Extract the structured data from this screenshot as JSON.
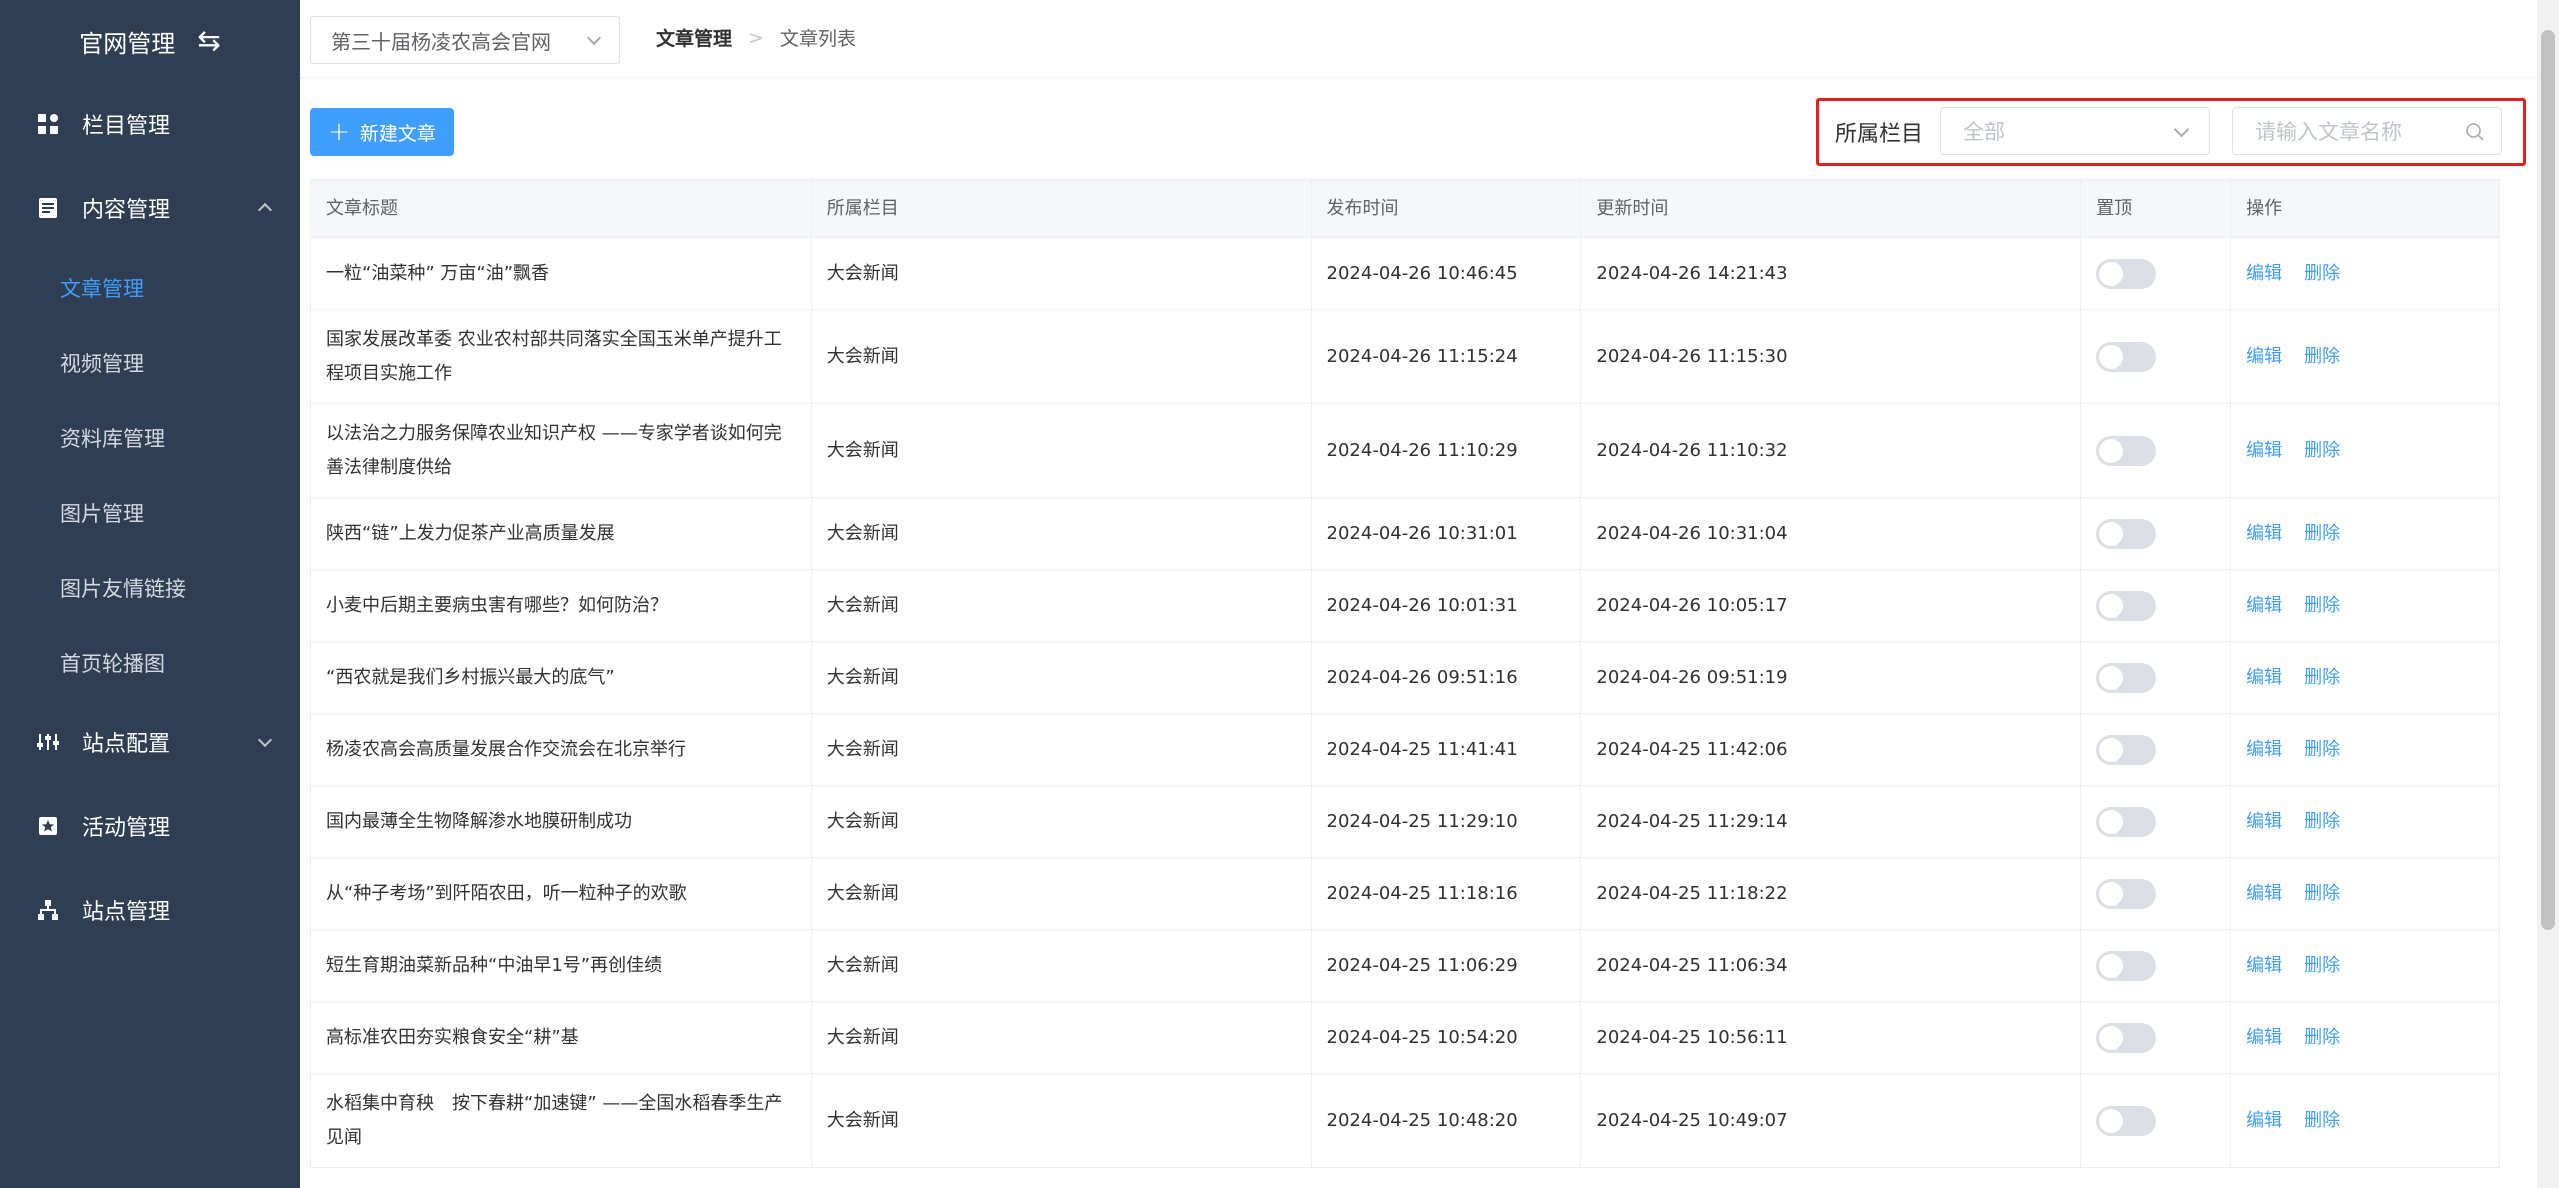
{
  "sidebar": {
    "brand": "官网管理",
    "swap_icon": "⇆",
    "menu": [
      {
        "label": "栏目管理",
        "icon": "grid-icon"
      },
      {
        "label": "内容管理",
        "icon": "document-icon"
      },
      {
        "label": "站点配置",
        "icon": "sliders-icon"
      },
      {
        "label": "活动管理",
        "icon": "star-box-icon"
      },
      {
        "label": "站点管理",
        "icon": "sitemap-icon"
      }
    ],
    "submenu": [
      "文章管理",
      "视频管理",
      "资料库管理",
      "图片管理",
      "图片友情链接",
      "首页轮播图"
    ],
    "active_sub": "文章管理"
  },
  "header": {
    "site_select_value": "第三十届杨凌农高会官网",
    "breadcrumb": [
      "文章管理",
      "文章列表"
    ],
    "breadcrumb_sep": ">"
  },
  "toolbar": {
    "new_label": "新建文章",
    "filter_label": "所属栏目",
    "filter_select_placeholder": "全部",
    "search_placeholder": "请输入文章名称"
  },
  "table": {
    "columns": [
      "文章标题",
      "所属栏目",
      "发布时间",
      "更新时间",
      "置顶",
      "操作"
    ],
    "edit_label": "编辑",
    "delete_label": "删除",
    "rows": [
      {
        "title": "一粒“油菜种” 万亩“油”飘香",
        "category": "大会新闻",
        "published": "2024-04-26 10:46:45",
        "updated": "2024-04-26 14:21:43",
        "pinned": false
      },
      {
        "title": "国家发展改革委 农业农村部共同落实全国玉米单产提升工程项目实施工作",
        "category": "大会新闻",
        "published": "2024-04-26 11:15:24",
        "updated": "2024-04-26 11:15:30",
        "pinned": false
      },
      {
        "title": "以法治之力服务保障农业知识产权 ——专家学者谈如何完善法律制度供给",
        "category": "大会新闻",
        "published": "2024-04-26 11:10:29",
        "updated": "2024-04-26 11:10:32",
        "pinned": false
      },
      {
        "title": "陕西“链”上发力促茶产业高质量发展",
        "category": "大会新闻",
        "published": "2024-04-26 10:31:01",
        "updated": "2024-04-26 10:31:04",
        "pinned": false
      },
      {
        "title": "小麦中后期主要病虫害有哪些？如何防治？",
        "category": "大会新闻",
        "published": "2024-04-26 10:01:31",
        "updated": "2024-04-26 10:05:17",
        "pinned": false
      },
      {
        "title": "“西农就是我们乡村振兴最大的底气”",
        "category": "大会新闻",
        "published": "2024-04-26 09:51:16",
        "updated": "2024-04-26 09:51:19",
        "pinned": false
      },
      {
        "title": "杨凌农高会高质量发展合作交流会在北京举行",
        "category": "大会新闻",
        "published": "2024-04-25 11:41:41",
        "updated": "2024-04-25 11:42:06",
        "pinned": false
      },
      {
        "title": "国内最薄全生物降解渗水地膜研制成功",
        "category": "大会新闻",
        "published": "2024-04-25 11:29:10",
        "updated": "2024-04-25 11:29:14",
        "pinned": false
      },
      {
        "title": "从“种子考场”到阡陌农田，听一粒种子的欢歌",
        "category": "大会新闻",
        "published": "2024-04-25 11:18:16",
        "updated": "2024-04-25 11:18:22",
        "pinned": false
      },
      {
        "title": "短生育期油菜新品种“中油早1号”再创佳绩",
        "category": "大会新闻",
        "published": "2024-04-25 11:06:29",
        "updated": "2024-04-25 11:06:34",
        "pinned": false
      },
      {
        "title": "高标准农田夯实粮食安全“耕”基",
        "category": "大会新闻",
        "published": "2024-04-25 10:54:20",
        "updated": "2024-04-25 10:56:11",
        "pinned": false
      },
      {
        "title": "水稻集中育秧　按下春耕“加速键” ——全国水稻春季生产见闻",
        "category": "大会新闻",
        "published": "2024-04-25 10:48:20",
        "updated": "2024-04-25 10:49:07",
        "pinned": false
      }
    ]
  }
}
